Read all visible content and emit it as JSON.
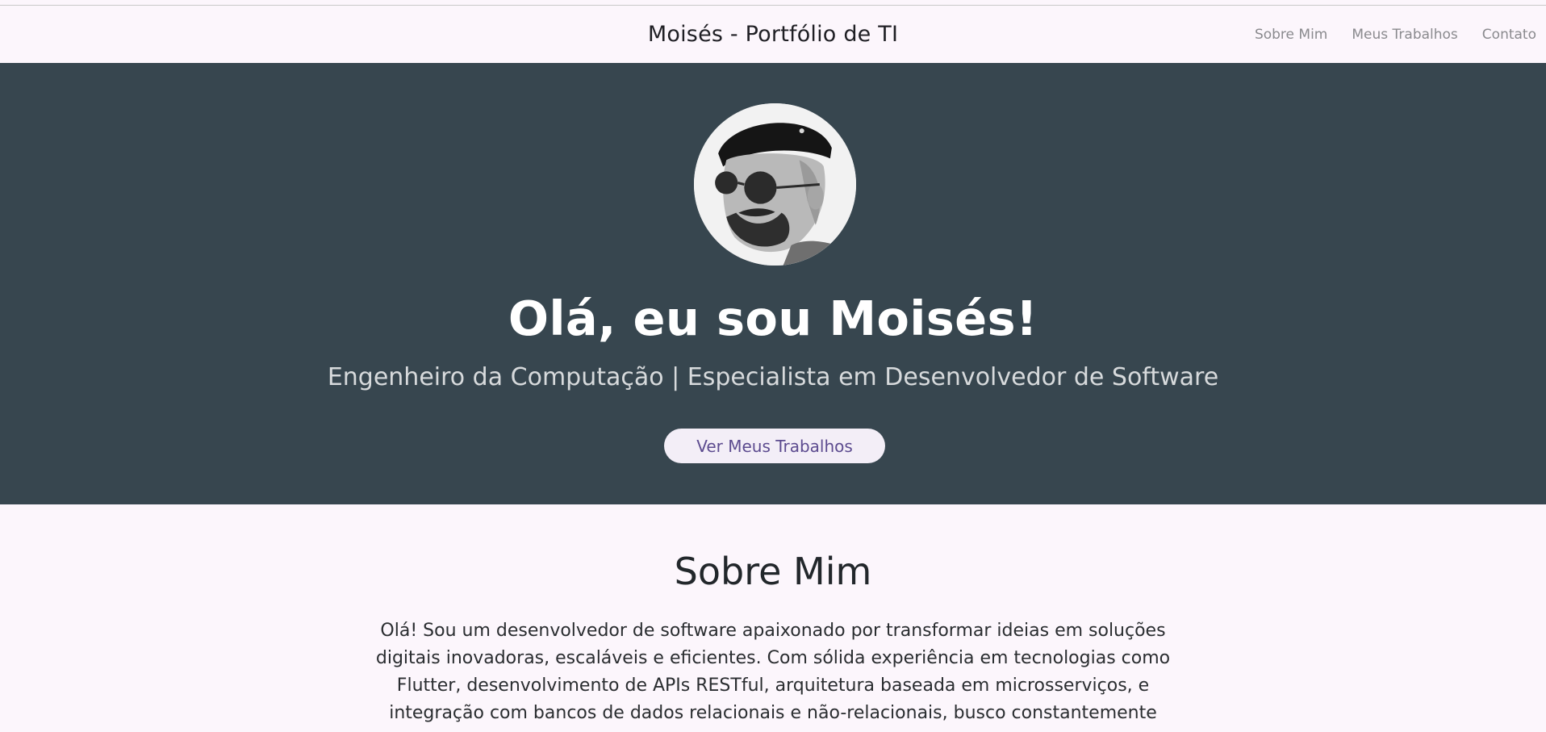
{
  "navbar": {
    "brand": "Moisés - Portfólio de TI",
    "links": [
      "Sobre Mim",
      "Meus Trabalhos",
      "Contato"
    ]
  },
  "hero": {
    "title": "Olá, eu sou Moisés!",
    "subtitle": "Engenheiro da Computação | Especialista em Desenvolvedor de Software",
    "cta_label": "Ver Meus Trabalhos"
  },
  "about": {
    "title": "Sobre Mim",
    "text": "Olá! Sou um desenvolvedor de software apaixonado por transformar ideias em soluções digitais inovadoras, escaláveis e eficientes. Com sólida experiência em tecnologias como Flutter, desenvolvimento de APIs RESTful, arquitetura baseada em microsserviços, e integração com bancos de dados relacionais e não-relacionais, busco constantemente"
  },
  "colors": {
    "hero_background": "#37464f",
    "page_background": "#fcf6fc",
    "button_text": "#5c4b8f"
  }
}
